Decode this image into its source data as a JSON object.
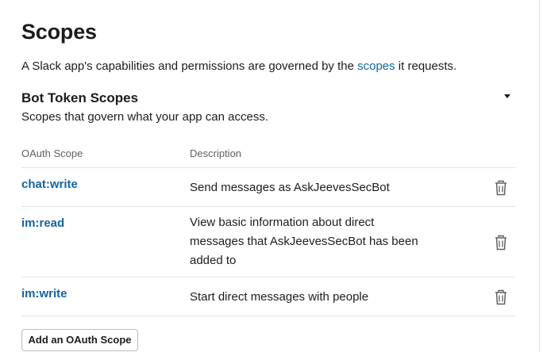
{
  "page": {
    "title": "Scopes",
    "intro": {
      "before": "A Slack app's capabilities and permissions are governed by the ",
      "link": "scopes",
      "after": " it requests."
    }
  },
  "bot_token_scopes": {
    "title": "Bot Token Scopes",
    "subtitle": "Scopes that govern what your app can access.",
    "toggle_icon": "caret-down-icon",
    "columns": {
      "scope": "OAuth Scope",
      "description": "Description"
    },
    "rows": [
      {
        "scope": "chat:write",
        "description": "Send messages as AskJeevesSecBot",
        "action_icon": "trash-icon"
      },
      {
        "scope": "im:read",
        "description": "View basic information about direct messages that AskJeevesSecBot has been added to",
        "action_icon": "trash-icon"
      },
      {
        "scope": "im:write",
        "description": "Start direct messages with people",
        "action_icon": "trash-icon"
      }
    ],
    "add_button_label": "Add an OAuth Scope"
  },
  "colors": {
    "link": "#1264a3",
    "text": "#1d1c1d",
    "muted": "#616061",
    "divider": "#e2e2e2"
  }
}
